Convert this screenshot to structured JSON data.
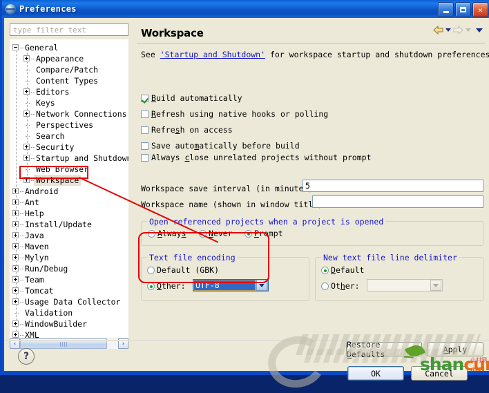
{
  "window": {
    "title": "Preferences",
    "icon": "preferences-globe-icon",
    "minimize_label": "Minimize",
    "maximize_label": "Maximize",
    "close_label": "Close"
  },
  "filter": {
    "placeholder": "type filter text",
    "value": ""
  },
  "tree": {
    "items": [
      {
        "label": "General",
        "depth": 0,
        "toggle": "minus",
        "selected": false
      },
      {
        "label": "Appearance",
        "depth": 1,
        "toggle": "plus",
        "selected": false
      },
      {
        "label": "Compare/Patch",
        "depth": 1,
        "toggle": "none",
        "selected": false
      },
      {
        "label": "Content Types",
        "depth": 1,
        "toggle": "none",
        "selected": false
      },
      {
        "label": "Editors",
        "depth": 1,
        "toggle": "plus",
        "selected": false
      },
      {
        "label": "Keys",
        "depth": 1,
        "toggle": "none",
        "selected": false
      },
      {
        "label": "Network Connections",
        "depth": 1,
        "toggle": "plus",
        "selected": false
      },
      {
        "label": "Perspectives",
        "depth": 1,
        "toggle": "none",
        "selected": false
      },
      {
        "label": "Search",
        "depth": 1,
        "toggle": "none",
        "selected": false
      },
      {
        "label": "Security",
        "depth": 1,
        "toggle": "plus",
        "selected": false
      },
      {
        "label": "Startup and Shutdown",
        "depth": 1,
        "toggle": "plus",
        "selected": false
      },
      {
        "label": "Web Browser",
        "depth": 1,
        "toggle": "none",
        "selected": false
      },
      {
        "label": "Workspace",
        "depth": 1,
        "toggle": "plus",
        "selected": true
      },
      {
        "label": "Android",
        "depth": 0,
        "toggle": "plus",
        "selected": false
      },
      {
        "label": "Ant",
        "depth": 0,
        "toggle": "plus",
        "selected": false
      },
      {
        "label": "Help",
        "depth": 0,
        "toggle": "plus",
        "selected": false
      },
      {
        "label": "Install/Update",
        "depth": 0,
        "toggle": "plus",
        "selected": false
      },
      {
        "label": "Java",
        "depth": 0,
        "toggle": "plus",
        "selected": false
      },
      {
        "label": "Maven",
        "depth": 0,
        "toggle": "plus",
        "selected": false
      },
      {
        "label": "Mylyn",
        "depth": 0,
        "toggle": "plus",
        "selected": false
      },
      {
        "label": "Run/Debug",
        "depth": 0,
        "toggle": "plus",
        "selected": false
      },
      {
        "label": "Team",
        "depth": 0,
        "toggle": "plus",
        "selected": false
      },
      {
        "label": "Tomcat",
        "depth": 0,
        "toggle": "plus",
        "selected": false
      },
      {
        "label": "Usage Data Collector",
        "depth": 0,
        "toggle": "plus",
        "selected": false
      },
      {
        "label": "Validation",
        "depth": 0,
        "toggle": "none",
        "selected": false
      },
      {
        "label": "WindowBuilder",
        "depth": 0,
        "toggle": "plus",
        "selected": false
      },
      {
        "label": "XML",
        "depth": 0,
        "toggle": "plus",
        "selected": false
      }
    ],
    "scroll_left_label": "‹",
    "scroll_right_label": "›"
  },
  "page": {
    "title": "Workspace",
    "nav": {
      "back_label": "Back",
      "forward_label": "Forward",
      "menu_label": "View Menu"
    },
    "intro": {
      "prefix": "See ",
      "link": "'Startup and Shutdown'",
      "suffix": " for workspace startup and shutdown preferences."
    },
    "checkboxes": [
      {
        "label": "Build automatically",
        "checked": true,
        "mnemonic": "B"
      },
      {
        "label": "Refresh using native hooks or polling",
        "checked": false,
        "mnemonic": "R"
      },
      {
        "label": "Refresh on access",
        "checked": false,
        "mnemonic": "s"
      },
      {
        "label": "Save automatically before build",
        "checked": false,
        "mnemonic": "m"
      },
      {
        "label": "Always close unrelated projects without prompt",
        "checked": false,
        "mnemonic": "c"
      }
    ],
    "fields": [
      {
        "label": "Workspace save interval (in minutes):",
        "value": "5"
      },
      {
        "label": "Workspace name (shown in window title):",
        "value": ""
      }
    ],
    "open_referenced_group": {
      "title": "Open referenced projects when a project is opened",
      "options": [
        {
          "label": "Always",
          "selected": false
        },
        {
          "label": "Never",
          "selected": false
        },
        {
          "label": "Prompt",
          "selected": true
        }
      ]
    },
    "text_file_encoding_group": {
      "title": "Text file encoding",
      "default_label": "Default (GBK)",
      "default_selected": false,
      "other_label": "Other:",
      "other_selected": true,
      "other_value": "UTF-8"
    },
    "line_delimiter_group": {
      "title": "New text file line delimiter",
      "default_label": "Default",
      "default_selected": true,
      "other_label": "Other:",
      "other_selected": false,
      "other_value": ""
    },
    "buttons": {
      "restore_defaults": "Restore Defaults",
      "apply": "Apply"
    }
  },
  "dialog_buttons": {
    "ok": "OK",
    "cancel": "Cancel"
  },
  "help": {
    "glyph": "?"
  },
  "watermark": {
    "brand_part1": "shan",
    "brand_part2": "cun",
    "domain": ".net",
    "cn_text": "山村网"
  },
  "colors": {
    "title_bar": "#0C55C8",
    "dialog_bg": "#ECE9D8",
    "group_title": "#1414C8",
    "link": "#1414C8",
    "annotation_red": "#E40000",
    "selection_blue": "#316AC5",
    "check_green": "#1D8E1D"
  }
}
